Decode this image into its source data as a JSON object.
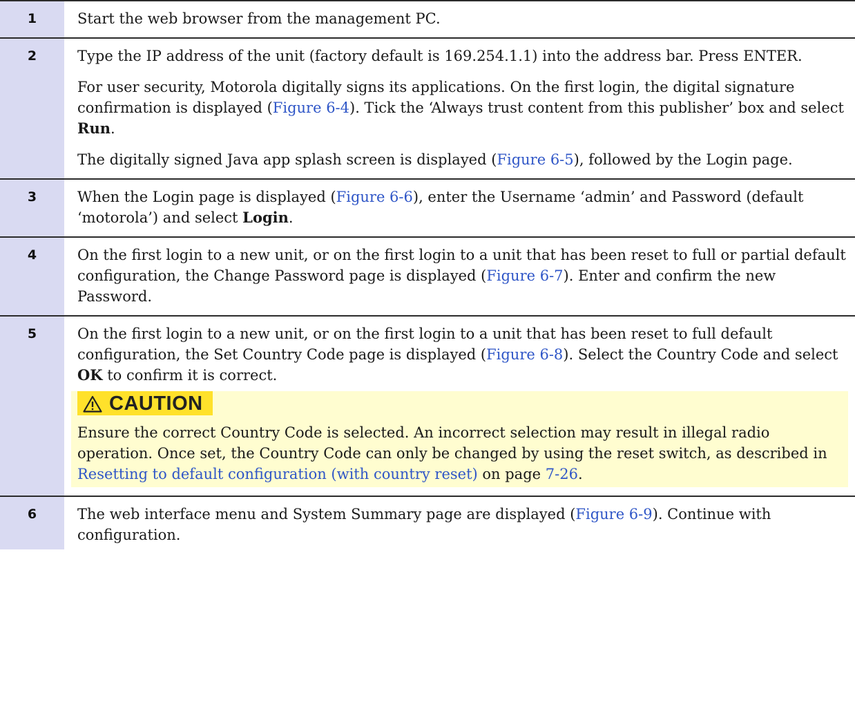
{
  "steps": [
    {
      "number": "1",
      "paragraphs": [
        {
          "text": "Start the web browser from the management PC."
        }
      ]
    },
    {
      "number": "2",
      "paragraphs": [
        {
          "text": "Type the IP address of the unit (factory default is 169.254.1.1) into the address bar. Press ENTER."
        },
        {
          "pre": "For user security, Motorola digitally signs its applications. On the first login, the digital signature confirmation is displayed (",
          "link": "Figure 6-4",
          "mid": "). Tick the ‘Always trust content from this publisher’ box and select ",
          "bold": "Run",
          "post": "."
        },
        {
          "pre": "The digitally signed Java app splash screen is displayed (",
          "link": "Figure 6-5",
          "post": "), followed by the Login page."
        }
      ]
    },
    {
      "number": "3",
      "paragraphs": [
        {
          "pre": "When the Login page is displayed (",
          "link": "Figure 6-6",
          "mid": "), enter the Username ‘admin’  and Password (default ‘motorola’) and select ",
          "bold": "Login",
          "post": "."
        }
      ]
    },
    {
      "number": "4",
      "paragraphs": [
        {
          "pre": "On the first login to a new unit, or on the first login to a unit that has been reset to full or partial default configuration, the Change Password page is displayed (",
          "link": "Figure 6-7",
          "post": "). Enter and confirm the new Password."
        }
      ]
    },
    {
      "number": "5",
      "paragraphs": [
        {
          "pre": "On the first login to a new unit, or on the first login to a unit that has been reset to full default configuration, the Set Country Code page is displayed (",
          "link": "Figure 6-8",
          "mid": "). Select the Country Code and select ",
          "bold": "OK",
          "post": " to confirm it is correct."
        }
      ],
      "caution": {
        "label": "CAUTION",
        "text_pre": "Ensure the correct Country Code is selected. An incorrect selection may result in illegal radio operation. Once set, the Country Code can only be changed by using the reset switch, as described in ",
        "link": "Resetting to default configuration (with country reset)",
        "text_mid": " on page ",
        "page_link": "7-26",
        "text_post": "."
      }
    },
    {
      "number": "6",
      "paragraphs": [
        {
          "pre": "The web interface menu and System Summary page are displayed (",
          "link": "Figure 6-9",
          "post": "). Continue with configuration."
        }
      ]
    }
  ],
  "colors": {
    "number_column": "#d9daf2",
    "link": "#2f56c7",
    "caution_background": "#fffdd0",
    "caution_label": "#ffe12b"
  }
}
